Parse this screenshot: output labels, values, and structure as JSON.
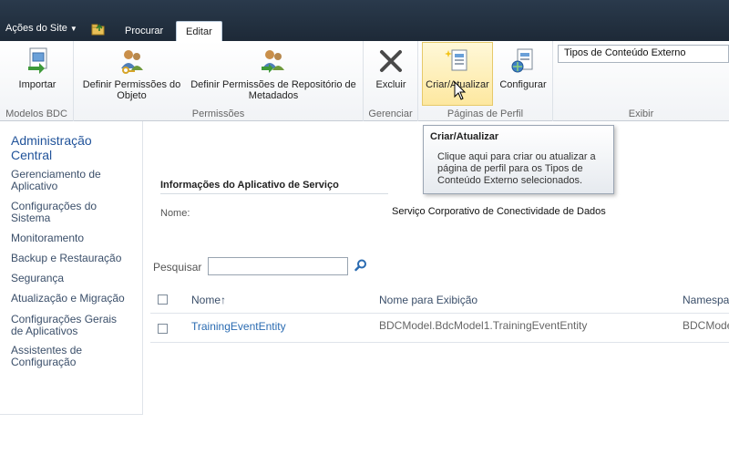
{
  "topbar": {
    "site_actions": "Ações do Site",
    "tabs": [
      {
        "label": "Procurar",
        "active": false
      },
      {
        "label": "Editar",
        "active": true
      }
    ]
  },
  "ribbon": {
    "groups": [
      {
        "label": "Modelos BDC",
        "buttons": [
          {
            "label": "Importar",
            "icon": "import-icon"
          }
        ]
      },
      {
        "label": "Permissões",
        "buttons": [
          {
            "label": "Definir Permissões do Objeto",
            "icon": "users-key-icon"
          },
          {
            "label": "Definir Permissões de Repositório de Metadados",
            "icon": "users-permissions-icon"
          }
        ]
      },
      {
        "label": "Gerenciar",
        "buttons": [
          {
            "label": "Excluir",
            "icon": "delete-x-icon"
          }
        ]
      },
      {
        "label": "Páginas de Perfil",
        "buttons": [
          {
            "label": "Criar/Atualizar",
            "icon": "create-update-page-icon"
          },
          {
            "label": "Configurar",
            "icon": "configure-page-icon"
          }
        ]
      },
      {
        "label": "Exibir",
        "combo_value": "Tipos de Conteúdo Externo"
      }
    ]
  },
  "tooltip": {
    "title": "Criar/Atualizar",
    "body": "Clique aqui para criar ou atualizar a página de perfil para os Tipos de Conteúdo Externo selecionados."
  },
  "leftnav": {
    "heading": "Administração Central",
    "items": [
      "Gerenciamento de Aplicativo",
      "Configurações do Sistema",
      "Monitoramento",
      "Backup e Restauração",
      "Segurança",
      "Atualização e Migração",
      "Configurações Gerais de Aplicativos",
      "Assistentes de Configuração"
    ]
  },
  "main": {
    "section_title": "Informações do Aplicativo de Serviço",
    "name_label": "Nome:",
    "name_value": "Serviço Corporativo de Conectividade de Dados",
    "search_label": "Pesquisar",
    "columns": [
      "Nome↑",
      "Nome para Exibição",
      "Namespa"
    ],
    "rows": [
      [
        "TrainingEventEntity",
        "BDCModel.BdcModel1.TrainingEventEntity",
        "BDCMode"
      ]
    ]
  },
  "colors": {
    "topbar": "#1d2937",
    "link": "#2a6bb1",
    "nav_heading": "#21539a",
    "hover_button": "#fde8a0"
  }
}
